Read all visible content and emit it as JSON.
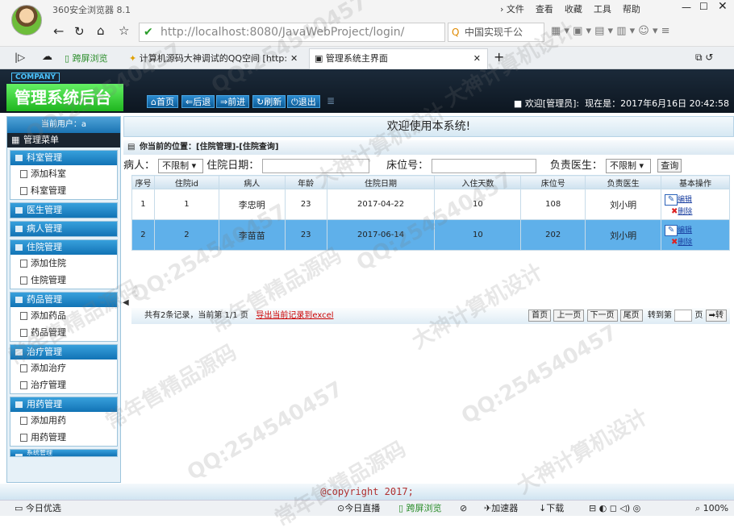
{
  "browser": {
    "name": "360安全浏览器 8.1",
    "menu": [
      "文件",
      "查看",
      "收藏",
      "工具",
      "帮助"
    ],
    "url_host": "http://localhost",
    "url_path": ":8080/JavaWebProject/login/",
    "search_text": "中国实现千公",
    "tabs": [
      {
        "label": "跨屏浏览"
      },
      {
        "label": "计算机源码大神调试的QQ空间 [http:"
      },
      {
        "label": "管理系统主界面"
      }
    ]
  },
  "app": {
    "company": "COMPANY",
    "title": "管理系统后台",
    "nav": [
      "首页",
      "后退",
      "前进",
      "刷新",
      "退出"
    ],
    "welcome_user": "欢迎[管理员]",
    "now_label": "现在是：2017年6月16日 20:42:58",
    "current_user": "当前用户：a",
    "menu_title": "管理菜单",
    "groups": [
      {
        "title": "科室管理",
        "items": [
          "添加科室",
          "科室管理"
        ]
      },
      {
        "title": "医生管理",
        "items": []
      },
      {
        "title": "病人管理",
        "items": []
      },
      {
        "title": "住院管理",
        "items": [
          "添加住院",
          "住院管理"
        ]
      },
      {
        "title": "药品管理",
        "items": [
          "添加药品",
          "药品管理"
        ]
      },
      {
        "title": "治疗管理",
        "items": [
          "添加治疗",
          "治疗管理"
        ]
      },
      {
        "title": "用药管理",
        "items": [
          "添加用药",
          "用药管理"
        ]
      },
      {
        "title": "系统管理",
        "items": []
      }
    ]
  },
  "main": {
    "welcome": "欢迎使用本系统!",
    "location": "你当前的位置：[住院管理]-[住院查询]",
    "filter": {
      "patient_label": "病人：",
      "patient_value": "不限制",
      "date_label": "住院日期：",
      "bed_label": "床位号：",
      "doctor_label": "负责医生：",
      "doctor_value": "不限制",
      "query_btn": "查询"
    },
    "columns": [
      "序号",
      "住院id",
      "病人",
      "年龄",
      "住院日期",
      "入住天数",
      "床位号",
      "负责医生",
      "基本操作"
    ],
    "rows": [
      [
        "1",
        "1",
        "李忠明",
        "23",
        "2017-04-22",
        "10",
        "108",
        "刘小明"
      ],
      [
        "2",
        "2",
        "李苗苗",
        "23",
        "2017-06-14",
        "10",
        "202",
        "刘小明"
      ]
    ],
    "op_edit": "编辑",
    "op_delete": "删除",
    "pager": {
      "summary": "共有2条记录，当前第 1/1 页",
      "export": "导出当前记录到excel",
      "first": "首页",
      "prev": "上一页",
      "next": "下一页",
      "last": "尾页",
      "goto": "转到第",
      "page_unit": "页",
      "go": "转"
    },
    "copyright": "@copyright 2017;"
  },
  "statusbar": {
    "left": "今日优选",
    "items": [
      "今日直播",
      "跨屏浏览",
      "加速器",
      "下载"
    ],
    "zoom": "100%"
  },
  "watermarks": [
    "QQ:254540457",
    "大神计算机设计",
    "常年售精品源码"
  ]
}
